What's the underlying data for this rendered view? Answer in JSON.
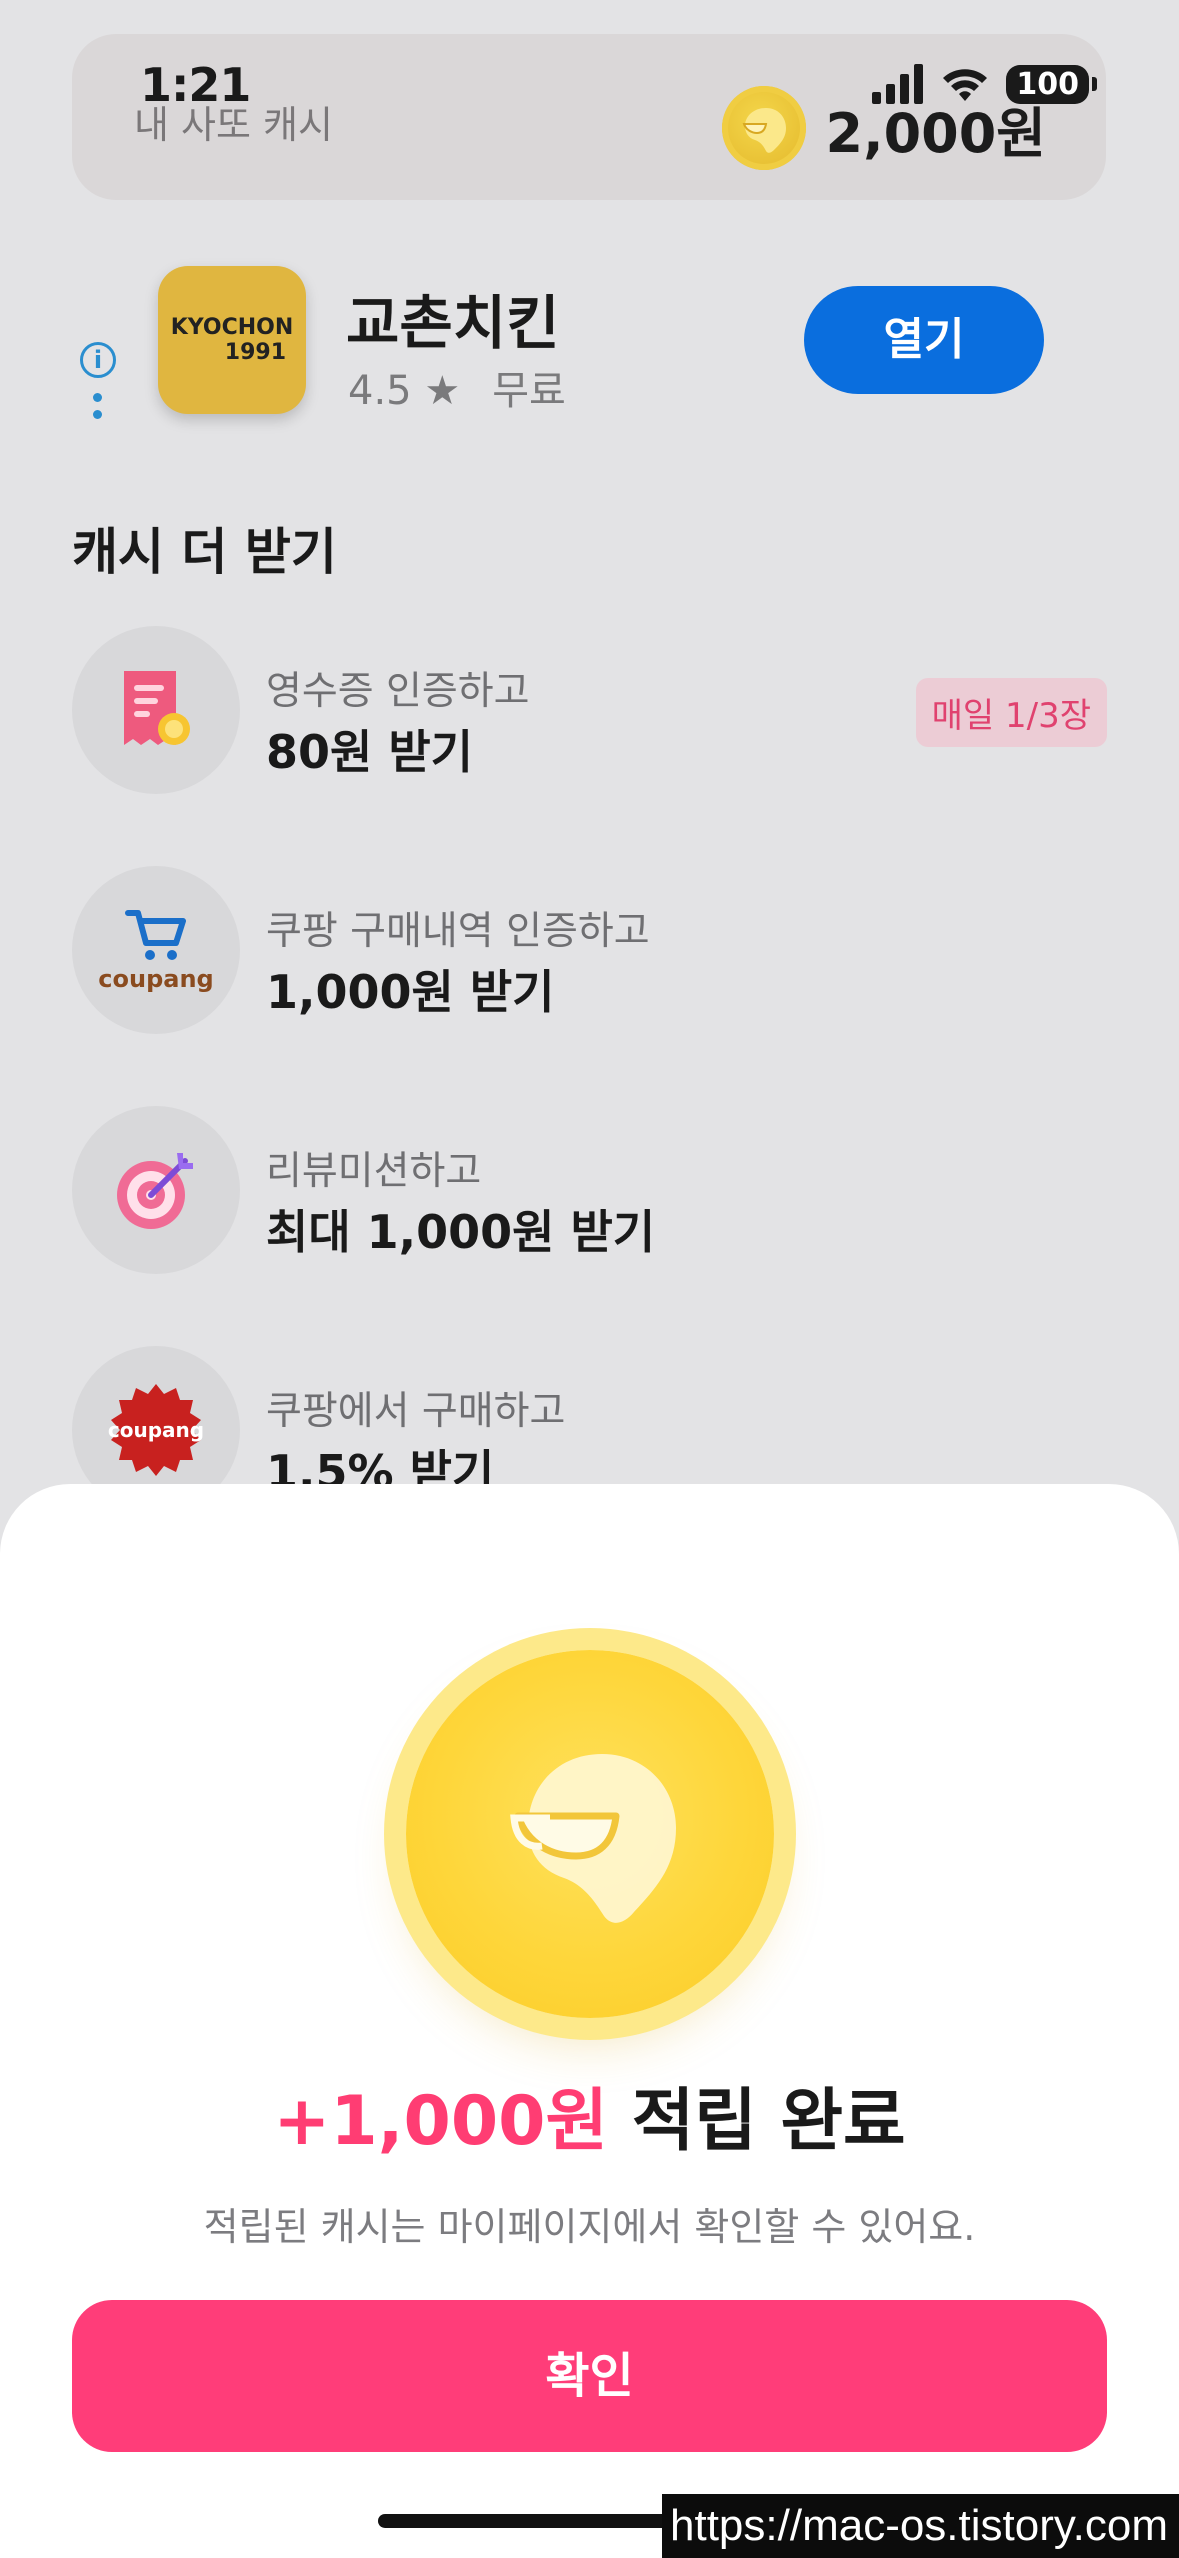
{
  "status_bar": {
    "time": "1:21",
    "battery": "100"
  },
  "cash_card": {
    "label": "내 사또 캐시",
    "amount": "2,000원"
  },
  "app": {
    "name": "교촌치킨",
    "rating": "4.5 ★",
    "price": "무료",
    "open_label": "열기",
    "logo_line1": "KYOCHON",
    "logo_line2": "1991"
  },
  "section_title": "캐시 더 받기",
  "items": [
    {
      "sub": "영수증 인증하고",
      "main": "80원 받기",
      "badge": "매일 1/3장"
    },
    {
      "sub": "쿠팡 구매내역 인증하고",
      "main": "1,000원 받기",
      "icon_text": "coupang"
    },
    {
      "sub": "리뷰미션하고",
      "main": "최대 1,000원 받기"
    },
    {
      "sub": "쿠팡에서 구매하고",
      "main": "1.5% 받기",
      "icon_text": "coupang"
    }
  ],
  "sheet": {
    "amount": "+1,000원",
    "title_suffix": " 적립 완료",
    "description": "적립된 캐시는 마이페이지에서 확인할 수 있어요.",
    "confirm_label": "확인"
  },
  "watermark": "https://mac-os.tistory.com",
  "colors": {
    "accent_pink": "#ff3d79",
    "open_blue": "#0a6ede",
    "coin_yellow": "#fed63a"
  }
}
